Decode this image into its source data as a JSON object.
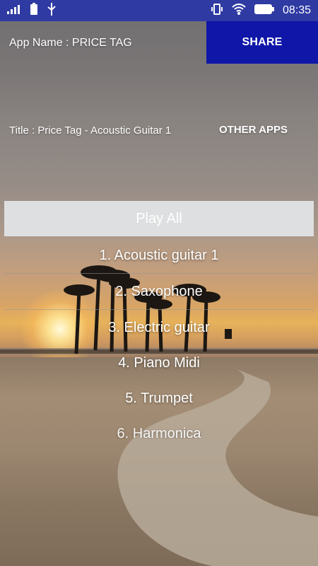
{
  "status_bar": {
    "time": "08:35",
    "left_icons": [
      "signal-icon",
      "battery-saver-icon",
      "usb-icon"
    ],
    "right_icons": [
      "vibrate-icon",
      "wifi-icon",
      "battery-icon"
    ]
  },
  "header": {
    "app_name": "App Name : PRICE TAG",
    "share_label": "SHARE",
    "share_color": "#0f16a8"
  },
  "info": {
    "title": "Title : Price Tag - Acoustic Guitar 1",
    "other_apps_label": "OTHER APPS"
  },
  "play_all_label": "Play All",
  "tracks": [
    "1. Acoustic guitar 1",
    "2. Saxophone",
    "3. Electric guitar",
    "4. Piano Midi",
    "5. Trumpet",
    "6. Harmonica"
  ]
}
